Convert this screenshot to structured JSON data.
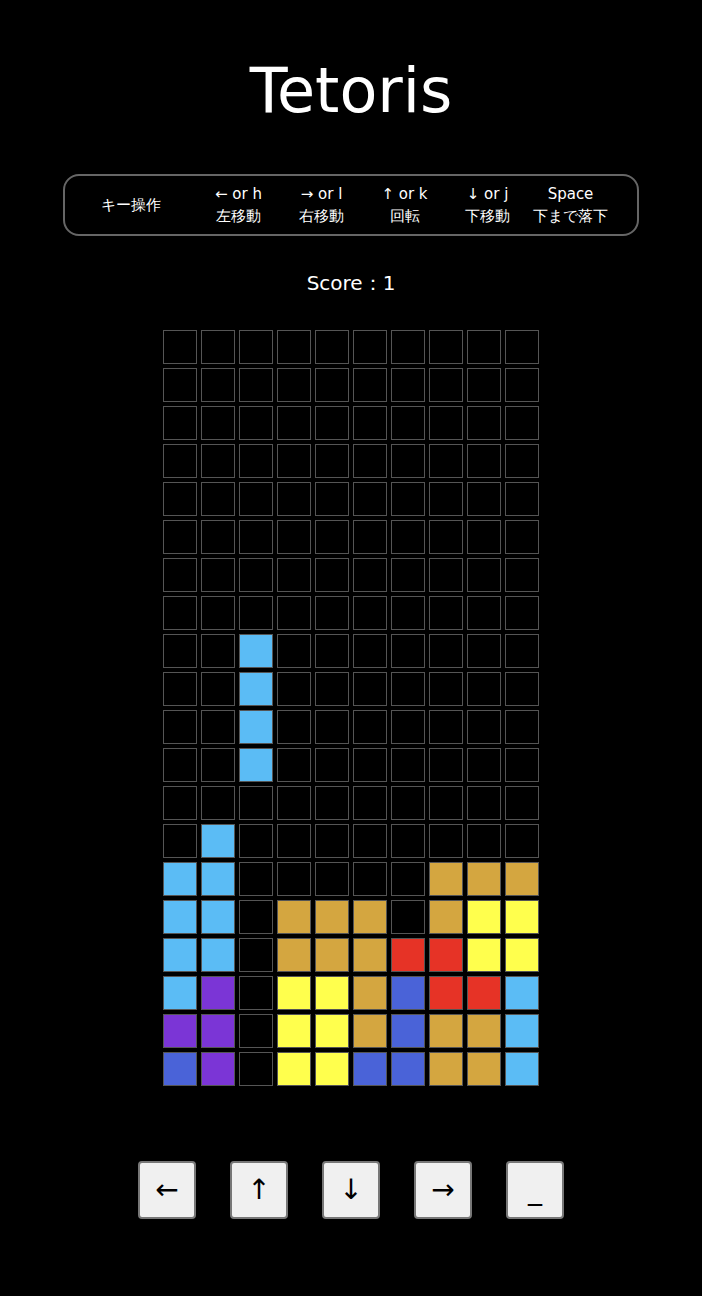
{
  "title": "Tetoris",
  "controls": {
    "label": "キー操作",
    "keys": [
      {
        "key": "← or h",
        "action": "左移動"
      },
      {
        "key": "→ or l",
        "action": "右移動"
      },
      {
        "key": "↑ or k",
        "action": "回転"
      },
      {
        "key": "↓ or j",
        "action": "下移動"
      },
      {
        "key": "Space",
        "action": "下まで落下"
      }
    ]
  },
  "score": {
    "text": "Score：1"
  },
  "board": {
    "rows": [
      [
        null,
        null,
        null,
        null,
        null,
        null,
        null,
        null,
        null,
        null
      ],
      [
        null,
        null,
        null,
        null,
        null,
        null,
        null,
        null,
        null,
        null
      ],
      [
        null,
        null,
        null,
        null,
        null,
        null,
        null,
        null,
        null,
        null
      ],
      [
        null,
        null,
        null,
        null,
        null,
        null,
        null,
        null,
        null,
        null
      ],
      [
        null,
        null,
        null,
        null,
        null,
        null,
        null,
        null,
        null,
        null
      ],
      [
        null,
        null,
        null,
        null,
        null,
        null,
        null,
        null,
        null,
        null
      ],
      [
        null,
        null,
        null,
        null,
        null,
        null,
        null,
        null,
        null,
        null
      ],
      [
        null,
        null,
        null,
        null,
        null,
        null,
        null,
        null,
        null,
        null
      ],
      [
        null,
        null,
        "#5bbcf5",
        null,
        null,
        null,
        null,
        null,
        null,
        null
      ],
      [
        null,
        null,
        "#5bbcf5",
        null,
        null,
        null,
        null,
        null,
        null,
        null
      ],
      [
        null,
        null,
        "#5bbcf5",
        null,
        null,
        null,
        null,
        null,
        null,
        null
      ],
      [
        null,
        null,
        "#5bbcf5",
        null,
        null,
        null,
        null,
        null,
        null,
        null
      ],
      [
        null,
        null,
        null,
        null,
        null,
        null,
        null,
        null,
        null,
        null
      ],
      [
        null,
        "#5bbcf5",
        null,
        null,
        null,
        null,
        null,
        null,
        null,
        null
      ],
      [
        "#5bbcf5",
        "#5bbcf5",
        null,
        null,
        null,
        null,
        null,
        "#d4a640",
        "#d4a640",
        "#d4a640"
      ],
      [
        "#5bbcf5",
        "#5bbcf5",
        null,
        "#d4a640",
        "#d4a640",
        "#d4a640",
        null,
        "#d4a640",
        "#ffff4d",
        "#ffff4d"
      ],
      [
        "#5bbcf5",
        "#5bbcf5",
        null,
        "#d4a640",
        "#d4a640",
        "#d4a640",
        "#e63326",
        "#e63326",
        "#ffff4d",
        "#ffff4d"
      ],
      [
        "#5bbcf5",
        "#7b35d6",
        null,
        "#ffff4d",
        "#ffff4d",
        "#d4a640",
        "#4a63d8",
        "#e63326",
        "#e63326",
        "#5bbcf5"
      ],
      [
        "#7b35d6",
        "#7b35d6",
        null,
        "#ffff4d",
        "#ffff4d",
        "#d4a640",
        "#4a63d8",
        "#d4a640",
        "#d4a640",
        "#5bbcf5"
      ],
      [
        "#4a63d8",
        "#7b35d6",
        null,
        "#ffff4d",
        "#ffff4d",
        "#4a63d8",
        "#4a63d8",
        "#d4a640",
        "#d4a640",
        "#5bbcf5"
      ]
    ]
  },
  "buttons": [
    {
      "label": "←"
    },
    {
      "label": "↑"
    },
    {
      "label": "↓"
    },
    {
      "label": "→"
    },
    {
      "label": "_"
    }
  ]
}
